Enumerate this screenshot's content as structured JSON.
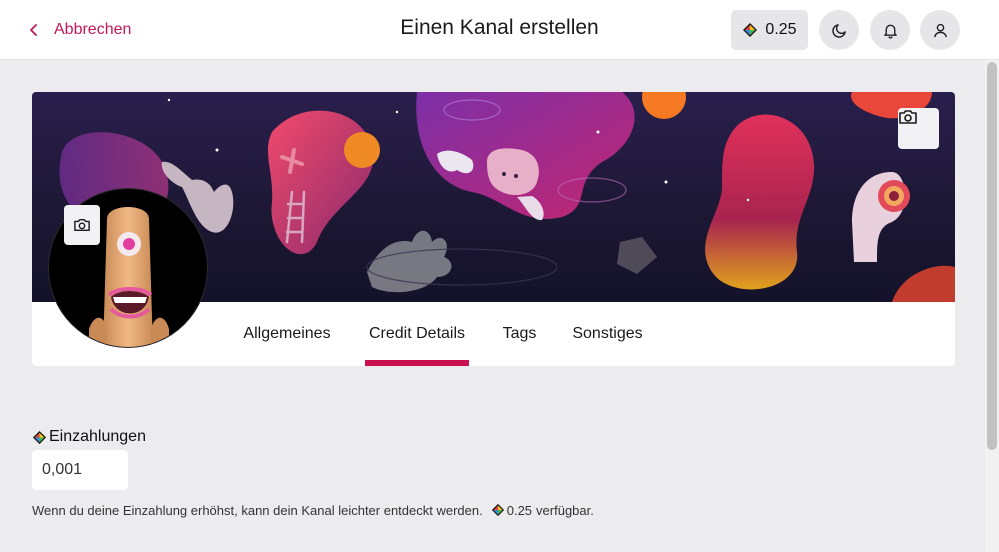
{
  "header": {
    "back_label": "Abbrechen",
    "title": "Einen Kanal erstellen",
    "credit_balance": "0.25"
  },
  "tabs": [
    {
      "label": "Allgemeines",
      "active": false
    },
    {
      "label": "Credit Details",
      "active": true
    },
    {
      "label": "Tags",
      "active": false
    },
    {
      "label": "Sonstiges",
      "active": false
    }
  ],
  "deposit": {
    "label": "Einzahlungen",
    "value": "0,001",
    "help_text": "Wenn du deine Einzahlung erhöhst, kann dein Kanal leichter entdeckt werden.",
    "available_amount": "0.25",
    "available_suffix": "verfügbar."
  },
  "icons": {
    "back": "chevron-left-icon",
    "credits": "lbc-credits-icon",
    "theme": "moon-icon",
    "notifications": "bell-icon",
    "account": "user-icon",
    "camera": "camera-icon"
  },
  "colors": {
    "accent": "#c8104f",
    "link": "#c2185b",
    "background": "#ececee"
  }
}
